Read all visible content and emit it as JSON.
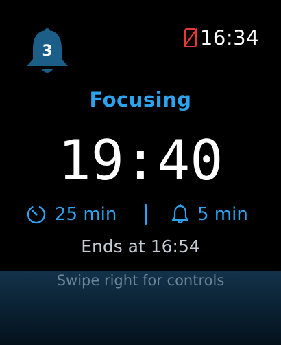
{
  "notifications": {
    "count": "3",
    "icon": "bell-icon"
  },
  "status_bar": {
    "time": "16:34",
    "phone_icon": "phone-disconnected-icon",
    "phone_color": "#e53935"
  },
  "session": {
    "mode": "Focusing",
    "remaining": "19:40",
    "focus_duration": "25 min",
    "break_duration": "5 min",
    "ends_at": "Ends at 16:54"
  },
  "hint": "Swipe right for controls",
  "colors": {
    "accent": "#2ba3ee",
    "bell": "#1b5e87"
  }
}
